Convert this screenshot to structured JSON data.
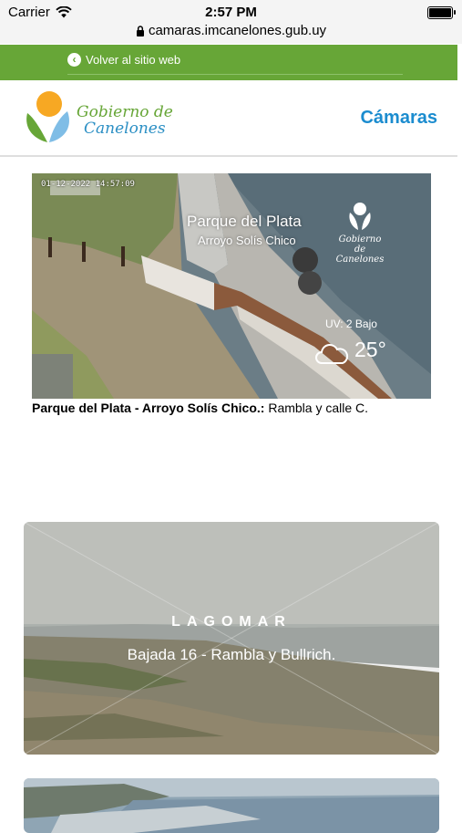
{
  "status_bar": {
    "carrier": "Carrier",
    "time": "2:57 PM"
  },
  "browser": {
    "url": "camaras.imcanelones.gub.uy"
  },
  "top_bar": {
    "back_label": "Volver al sitio web"
  },
  "header": {
    "logo_line1": "Gobierno de",
    "logo_line2": "Canelones",
    "section_title": "Cámaras"
  },
  "camera1": {
    "timestamp": "01-12-2022 14:57:09",
    "overlay_place": "Parque del Plata",
    "overlay_sub": "Arroyo Solís Chico",
    "watermark_line1": "Gobierno de",
    "watermark_line2": "Canelones",
    "uv": "UV: 2 Bajo",
    "temperature": "25°",
    "caption_bold": "Parque del Plata - Arroyo Solís Chico.:",
    "caption_text": " Rambla y calle C."
  },
  "camera2": {
    "title": "LAGOMAR",
    "subtitle": "Bajada 16 - Rambla y Bullrich."
  },
  "colors": {
    "green_bar": "#67a637",
    "accent_blue": "#1b8ccf"
  }
}
